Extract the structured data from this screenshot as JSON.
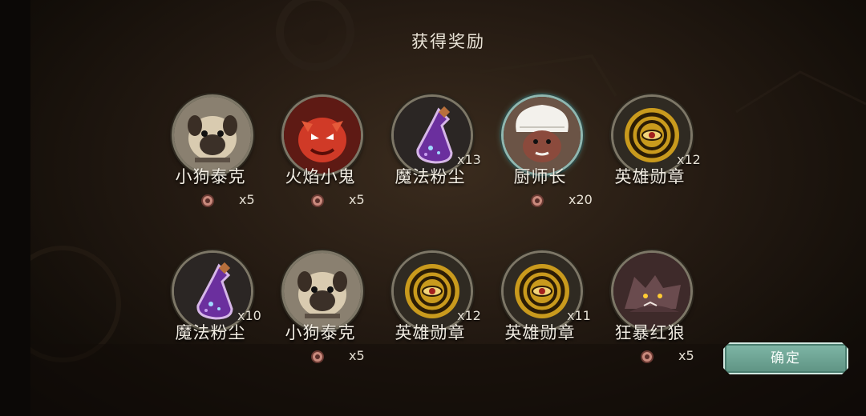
{
  "title": "获得奖励",
  "confirm_label": "确定",
  "rewards": [
    {
      "name": "小狗泰克",
      "icon": "pug-icon",
      "qty": "",
      "shard_count": "x5"
    },
    {
      "name": "火焰小鬼",
      "icon": "fire-imp-icon",
      "qty": "",
      "shard_count": "x5"
    },
    {
      "name": "魔法粉尘",
      "icon": "magic-dust-potion-icon",
      "qty": "x13",
      "shard_count": ""
    },
    {
      "name": "厨师长",
      "icon": "chef-icon",
      "qty": "",
      "shard_count": "x20"
    },
    {
      "name": "英雄勋章",
      "icon": "hero-medal-icon",
      "qty": "x12",
      "shard_count": ""
    },
    {
      "name": "魔法粉尘",
      "icon": "magic-dust-potion-icon",
      "qty": "x10",
      "shard_count": ""
    },
    {
      "name": "小狗泰克",
      "icon": "pug-icon",
      "qty": "",
      "shard_count": "x5"
    },
    {
      "name": "英雄勋章",
      "icon": "hero-medal-icon",
      "qty": "x12",
      "shard_count": ""
    },
    {
      "name": "英雄勋章",
      "icon": "hero-medal-icon",
      "qty": "x11",
      "shard_count": ""
    },
    {
      "name": "狂暴红狼",
      "icon": "red-wolf-icon",
      "qty": "",
      "shard_count": "x5"
    }
  ],
  "colors": {
    "accent": "#6fa696",
    "text": "#f1ece2",
    "highlight_ring": "#8fb7b0"
  }
}
